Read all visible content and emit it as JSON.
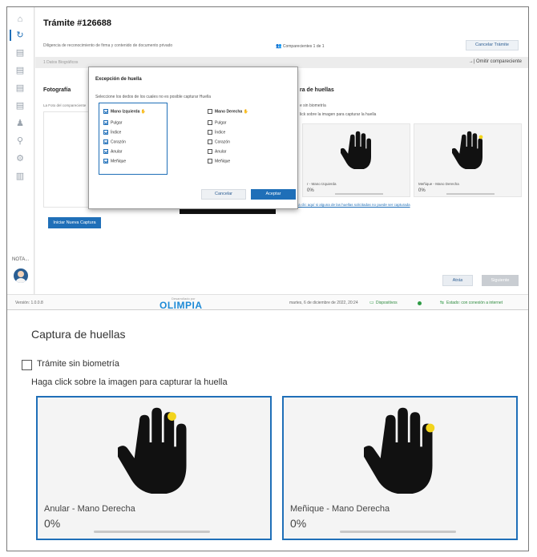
{
  "app": {
    "title": "Trámite #126688",
    "subtitle": "Diligencia de reconocimiento de firma y contenido de documento privado",
    "comparecientes": "Comparecientes 1 de 1",
    "cancel_tramite": "Cancelar Trámite",
    "tab_datos": "1 Datos Biográficos",
    "omitir": "→| Omitir compareciente",
    "fotografia": "Fotografía",
    "foto_note": "La Foto del compareciente",
    "nueva_captura": "Iniciar Nueva Captura",
    "atras": "Atrás",
    "siguiente": "Siguiente",
    "nota": "NOTA...",
    "captura_small": "ra de huellas",
    "sin_small": "e sin biometría",
    "haga_small": "lick sobre la imagen para capturar la huella",
    "mini_cards": [
      {
        "label": "r - Mano Izquierda",
        "percent": "0%"
      },
      {
        "label": "Meñique - Mano Derecha",
        "percent": "0%"
      }
    ],
    "link_fallo": "Haga clic aquí si alguna de las huellas solicitadas no puede ser capturada"
  },
  "statusbar": {
    "version": "Versión: 1.0.0.8",
    "developed_by": "Desarrollado por",
    "logo": "OLIMPIA",
    "datetime": "martes, 6 de diciembre de 2022, 20:24",
    "dispositivos": "Dispositivos",
    "estado": "Estado: con conexión a internet"
  },
  "modal": {
    "title": "Excepción de huella",
    "subtitle": "Seleccione los dedos de los cuales no es posible capturar Huella",
    "left": {
      "head": "Mano Izquierda",
      "items": [
        "Pulgar",
        "Índice",
        "Corazón",
        "Anular",
        "Meñique"
      ]
    },
    "right": {
      "head": "Mano Derecha",
      "items": [
        "Pulgar",
        "Índice",
        "Corazón",
        "Anular",
        "Meñique"
      ]
    },
    "cancel": "Cancelar",
    "accept": "Aceptar"
  },
  "zoom": {
    "title": "Captura de huellas",
    "sin_biometria": "Trámite sin biometría",
    "haga_click": "Haga click sobre la imagen para capturar la huella",
    "cards": [
      {
        "label": "Anular - Mano Derecha",
        "percent": "0%",
        "progress": 0
      },
      {
        "label": "Meñique - Mano Derecha",
        "percent": "0%",
        "progress": 0
      }
    ]
  },
  "colors": {
    "accent": "#1f6fb8",
    "highlight_dot": "#f2d41c",
    "status_green": "#2e9b45"
  },
  "icons": [
    "home-icon",
    "refresh-icon",
    "document-icon",
    "user-icon",
    "fingerprint-icon",
    "settings-icon",
    "chart-icon",
    "hand-icon"
  ]
}
